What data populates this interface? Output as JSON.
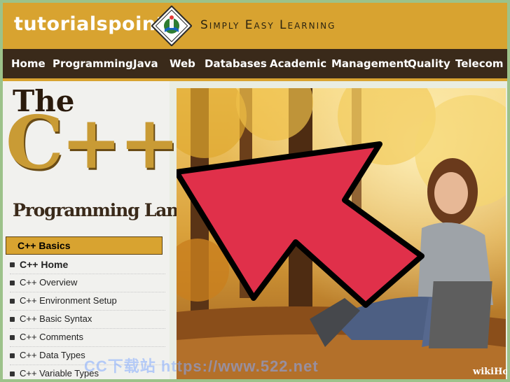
{
  "header": {
    "brand": "tutorialspoint",
    "tagline": "Simply Easy Learning"
  },
  "nav": {
    "items": [
      "Home",
      "Programming",
      "Java",
      "Web",
      "Databases",
      "Academic",
      "Management",
      "Quality",
      "Telecom"
    ]
  },
  "banner": {
    "line1": "The",
    "line2": "C++",
    "line3": "Programming Language"
  },
  "sidebar": {
    "section_title": "C++ Basics",
    "items": [
      "C++ Home",
      "C++ Overview",
      "C++ Environment Setup",
      "C++ Basic Syntax",
      "C++ Comments",
      "C++ Data Types",
      "C++ Variable Types"
    ]
  },
  "overlay": {
    "watermark": "CC下载站 https://www.522.net",
    "credit": "wikiHow"
  },
  "colors": {
    "header_gold": "#d8a330",
    "nav_brown": "#3a2a1a",
    "arrow_red": "#e0304a"
  }
}
